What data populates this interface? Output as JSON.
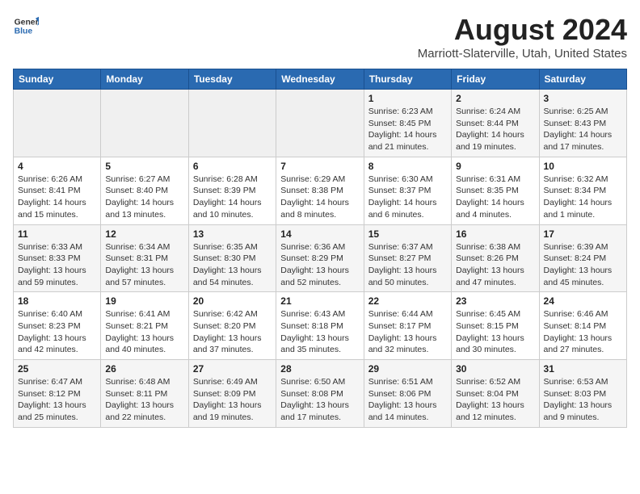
{
  "header": {
    "logo_general": "General",
    "logo_blue": "Blue",
    "title": "August 2024",
    "subtitle": "Marriott-Slaterville, Utah, United States"
  },
  "weekdays": [
    "Sunday",
    "Monday",
    "Tuesday",
    "Wednesday",
    "Thursday",
    "Friday",
    "Saturday"
  ],
  "weeks": [
    [
      {
        "day": "",
        "info": ""
      },
      {
        "day": "",
        "info": ""
      },
      {
        "day": "",
        "info": ""
      },
      {
        "day": "",
        "info": ""
      },
      {
        "day": "1",
        "info": "Sunrise: 6:23 AM\nSunset: 8:45 PM\nDaylight: 14 hours and 21 minutes."
      },
      {
        "day": "2",
        "info": "Sunrise: 6:24 AM\nSunset: 8:44 PM\nDaylight: 14 hours and 19 minutes."
      },
      {
        "day": "3",
        "info": "Sunrise: 6:25 AM\nSunset: 8:43 PM\nDaylight: 14 hours and 17 minutes."
      }
    ],
    [
      {
        "day": "4",
        "info": "Sunrise: 6:26 AM\nSunset: 8:41 PM\nDaylight: 14 hours and 15 minutes."
      },
      {
        "day": "5",
        "info": "Sunrise: 6:27 AM\nSunset: 8:40 PM\nDaylight: 14 hours and 13 minutes."
      },
      {
        "day": "6",
        "info": "Sunrise: 6:28 AM\nSunset: 8:39 PM\nDaylight: 14 hours and 10 minutes."
      },
      {
        "day": "7",
        "info": "Sunrise: 6:29 AM\nSunset: 8:38 PM\nDaylight: 14 hours and 8 minutes."
      },
      {
        "day": "8",
        "info": "Sunrise: 6:30 AM\nSunset: 8:37 PM\nDaylight: 14 hours and 6 minutes."
      },
      {
        "day": "9",
        "info": "Sunrise: 6:31 AM\nSunset: 8:35 PM\nDaylight: 14 hours and 4 minutes."
      },
      {
        "day": "10",
        "info": "Sunrise: 6:32 AM\nSunset: 8:34 PM\nDaylight: 14 hours and 1 minute."
      }
    ],
    [
      {
        "day": "11",
        "info": "Sunrise: 6:33 AM\nSunset: 8:33 PM\nDaylight: 13 hours and 59 minutes."
      },
      {
        "day": "12",
        "info": "Sunrise: 6:34 AM\nSunset: 8:31 PM\nDaylight: 13 hours and 57 minutes."
      },
      {
        "day": "13",
        "info": "Sunrise: 6:35 AM\nSunset: 8:30 PM\nDaylight: 13 hours and 54 minutes."
      },
      {
        "day": "14",
        "info": "Sunrise: 6:36 AM\nSunset: 8:29 PM\nDaylight: 13 hours and 52 minutes."
      },
      {
        "day": "15",
        "info": "Sunrise: 6:37 AM\nSunset: 8:27 PM\nDaylight: 13 hours and 50 minutes."
      },
      {
        "day": "16",
        "info": "Sunrise: 6:38 AM\nSunset: 8:26 PM\nDaylight: 13 hours and 47 minutes."
      },
      {
        "day": "17",
        "info": "Sunrise: 6:39 AM\nSunset: 8:24 PM\nDaylight: 13 hours and 45 minutes."
      }
    ],
    [
      {
        "day": "18",
        "info": "Sunrise: 6:40 AM\nSunset: 8:23 PM\nDaylight: 13 hours and 42 minutes."
      },
      {
        "day": "19",
        "info": "Sunrise: 6:41 AM\nSunset: 8:21 PM\nDaylight: 13 hours and 40 minutes."
      },
      {
        "day": "20",
        "info": "Sunrise: 6:42 AM\nSunset: 8:20 PM\nDaylight: 13 hours and 37 minutes."
      },
      {
        "day": "21",
        "info": "Sunrise: 6:43 AM\nSunset: 8:18 PM\nDaylight: 13 hours and 35 minutes."
      },
      {
        "day": "22",
        "info": "Sunrise: 6:44 AM\nSunset: 8:17 PM\nDaylight: 13 hours and 32 minutes."
      },
      {
        "day": "23",
        "info": "Sunrise: 6:45 AM\nSunset: 8:15 PM\nDaylight: 13 hours and 30 minutes."
      },
      {
        "day": "24",
        "info": "Sunrise: 6:46 AM\nSunset: 8:14 PM\nDaylight: 13 hours and 27 minutes."
      }
    ],
    [
      {
        "day": "25",
        "info": "Sunrise: 6:47 AM\nSunset: 8:12 PM\nDaylight: 13 hours and 25 minutes."
      },
      {
        "day": "26",
        "info": "Sunrise: 6:48 AM\nSunset: 8:11 PM\nDaylight: 13 hours and 22 minutes."
      },
      {
        "day": "27",
        "info": "Sunrise: 6:49 AM\nSunset: 8:09 PM\nDaylight: 13 hours and 19 minutes."
      },
      {
        "day": "28",
        "info": "Sunrise: 6:50 AM\nSunset: 8:08 PM\nDaylight: 13 hours and 17 minutes."
      },
      {
        "day": "29",
        "info": "Sunrise: 6:51 AM\nSunset: 8:06 PM\nDaylight: 13 hours and 14 minutes."
      },
      {
        "day": "30",
        "info": "Sunrise: 6:52 AM\nSunset: 8:04 PM\nDaylight: 13 hours and 12 minutes."
      },
      {
        "day": "31",
        "info": "Sunrise: 6:53 AM\nSunset: 8:03 PM\nDaylight: 13 hours and 9 minutes."
      }
    ]
  ]
}
